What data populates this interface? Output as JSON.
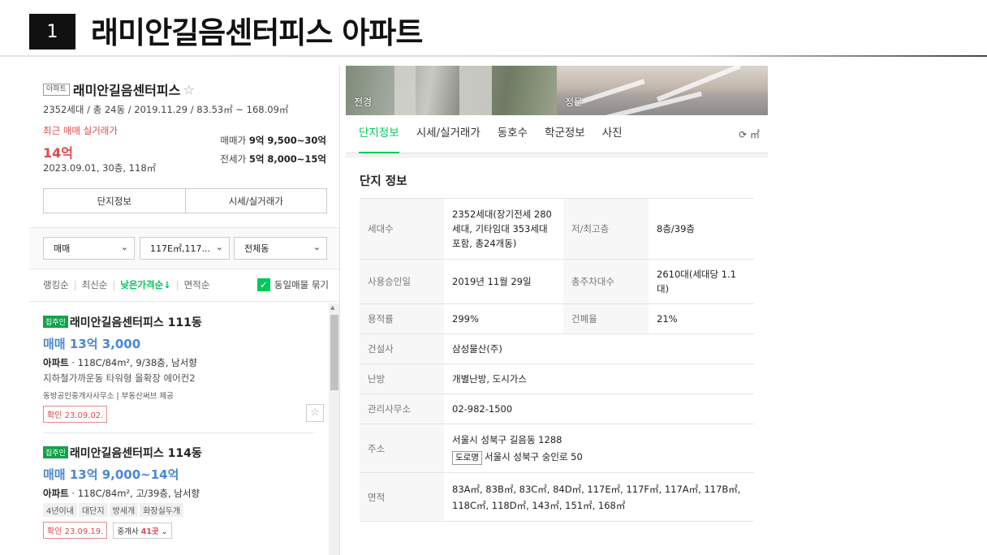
{
  "slide": {
    "number": "1",
    "title": "래미안길음센터피스 아파트"
  },
  "summary": {
    "type_badge": "아파트",
    "name": "래미안길음센터피스",
    "info": "2352세대 / 총 24동 / 2019.11.29 / 83.53㎡ ~ 168.09㎡",
    "recent_label": "최근 매매 실거래가",
    "recent_price": "14억",
    "recent_detail": "2023.09.01, 30층, 118㎡",
    "sale_label": "매매가",
    "sale_range": "9억 9,500~30억",
    "jeonse_label": "전세가",
    "jeonse_range": "5억 8,000~15억",
    "btn_complex": "단지정보",
    "btn_market": "시세/실거래가"
  },
  "filters": {
    "trade_type": "매매",
    "area": "117E㎡,117...",
    "dong": "전체동"
  },
  "sort": {
    "ranking": "랭킹순",
    "latest": "최신순",
    "low_price": "낮은가격순↓",
    "area": "면적순",
    "group_label": "동일매물 묶기"
  },
  "listings": [
    {
      "tag": "집주인",
      "name": "래미안길음센터피스 111동",
      "price": "매매 13억 3,000",
      "type": "아파트",
      "spec": "118C/84m², 9/38층, 남서향",
      "desc": "지하철가까운동 타워형 올확장 에어컨2",
      "agency": "동방공인중개사사무소  |  부동산써브 제공",
      "confirm": "확인 23.09.02."
    },
    {
      "tag": "집주인",
      "name": "래미안길음센터피스 114동",
      "price": "매매 13억 9,000~14억",
      "type": "아파트",
      "spec": "118C/84m², 고/39층, 남서향",
      "tags": [
        "4년이내",
        "대단지",
        "방세개",
        "화장실두개"
      ],
      "confirm": "확인 23.09.19.",
      "agent_label": "중개사",
      "agent_count": "41곳"
    }
  ],
  "photos": {
    "caption_exterior": "전경",
    "caption_gate": "정문"
  },
  "tabs": [
    "단지정보",
    "시세/실거래가",
    "동호수",
    "학군정보",
    "사진"
  ],
  "unit_toggle": "⟳ ㎡",
  "complex_info": {
    "title": "단지 정보",
    "households_label": "세대수",
    "households": "2352세대(장기전세 280세대, 기타임대 353세대 포함, 총24개동)",
    "floors_label": "저/최고층",
    "floors": "8층/39층",
    "approval_label": "사용승인일",
    "approval": "2019년 11월 29일",
    "parking_label": "총주차대수",
    "parking": "2610대(세대당 1.1대)",
    "far_label": "용적률",
    "far": "299%",
    "bcr_label": "건폐율",
    "bcr": "21%",
    "builder_label": "건설사",
    "builder": "삼성물산(주)",
    "heating_label": "난방",
    "heating": "개별난방, 도시가스",
    "office_label": "관리사무소",
    "office": "02-982-1500",
    "address_label": "주소",
    "address": "서울시 성북구 길음동 1288",
    "road_badge": "도로명",
    "road_address": "서울시 성북구 숭인로 50",
    "area_label": "면적",
    "areas": "83A㎡, 83B㎡, 83C㎡, 84D㎡, 117E㎡, 117F㎡, 117A㎡, 117B㎡, 118C㎡, 118D㎡, 143㎡, 151㎡, 168㎡"
  }
}
